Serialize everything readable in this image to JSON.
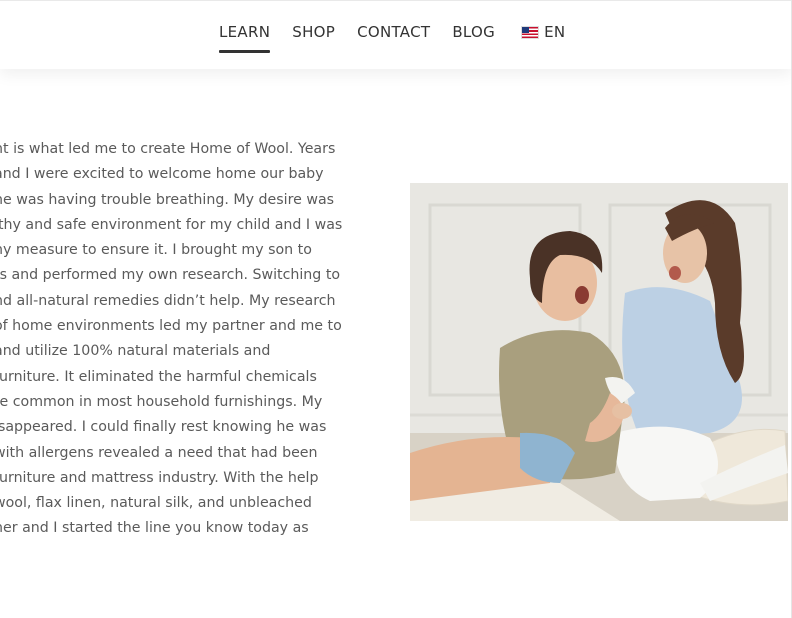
{
  "nav": {
    "items": [
      {
        "label": "LEARN",
        "active": true
      },
      {
        "label": "SHOP",
        "active": false
      },
      {
        "label": "CONTACT",
        "active": false
      },
      {
        "label": "BLOG",
        "active": false
      }
    ],
    "language": {
      "label": "EN",
      "flag_icon": "us-flag-icon"
    }
  },
  "article": {
    "lines": [
      "nt is what led me to create Home of Wool. Years",
      "and I were excited to welcome home our baby",
      "he was having trouble breathing. My desire was",
      "lthy and safe environment for my child and I was",
      "ny measure to ensure it. I brought my son to",
      "ts and performed my own research.  Switching to",
      "nd all-natural remedies didn’t help. My research",
      "of home environments led my partner and me to",
      "and utilize 100% natural materials and",
      "furniture. It eliminated the harmful chemicals",
      "re common in most household furnishings. My",
      "isappeared.  I could finally rest knowing he was",
      "with allergens revealed a need that had been",
      "furniture and mattress industry. With the help",
      "wool, flax linen, natural silk, and unbleached",
      "ner and I started the line you know today as"
    ]
  },
  "colors": {
    "nav_text": "#333333",
    "body_text": "#5a5a5a",
    "background": "#ffffff"
  }
}
